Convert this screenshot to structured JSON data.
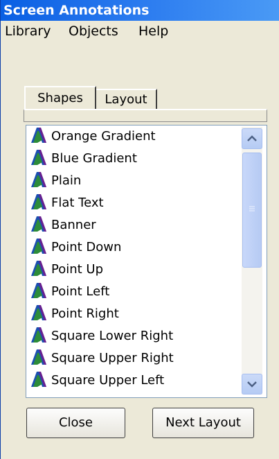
{
  "window": {
    "title": "Screen Annotations"
  },
  "menu": {
    "items": [
      "Library",
      "Objects",
      "Help"
    ]
  },
  "tabs": [
    {
      "label": "Shapes",
      "selected": true
    },
    {
      "label": "Layout",
      "selected": false
    }
  ],
  "shapes_list": {
    "items": [
      "Orange Gradient",
      "Blue Gradient",
      "Plain",
      "Flat Text",
      "Banner",
      "Point Down",
      "Point Up",
      "Point Left",
      "Point Right",
      "Square Lower Right",
      "Square Upper Right",
      "Square Upper Left"
    ],
    "item_icon": "shape-a-icon"
  },
  "buttons": {
    "close": "Close",
    "next_layout": "Next Layout"
  },
  "colors": {
    "titlebar": "#0a5fe3",
    "window_bg": "#ece9d8",
    "scrollbar": "#b6caf3"
  }
}
